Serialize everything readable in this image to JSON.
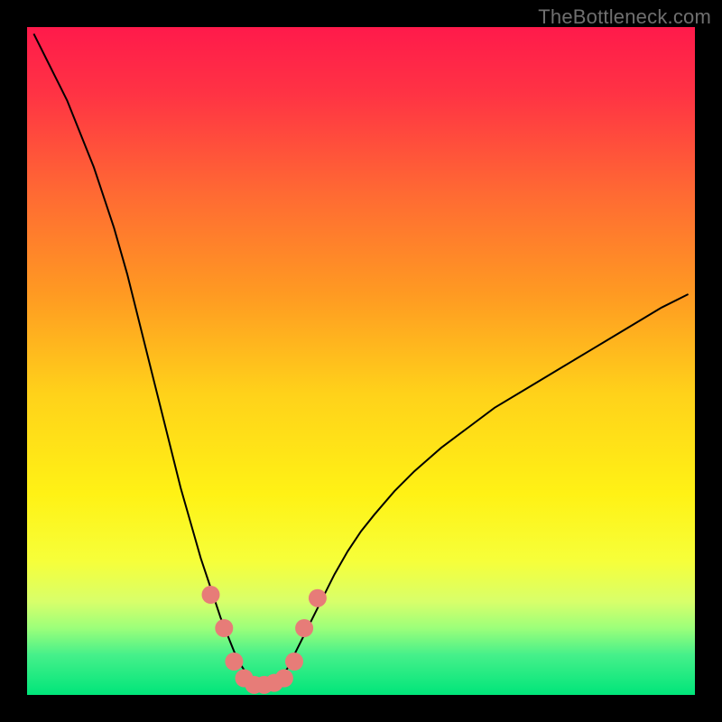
{
  "watermark": "TheBottleneck.com",
  "chart_data": {
    "type": "line",
    "title": "",
    "xlabel": "",
    "ylabel": "",
    "xlim": [
      0,
      100
    ],
    "ylim": [
      0,
      100
    ],
    "background_gradient": {
      "stops": [
        {
          "offset": 0.0,
          "color": "#ff1a4b"
        },
        {
          "offset": 0.1,
          "color": "#ff3344"
        },
        {
          "offset": 0.25,
          "color": "#ff6a33"
        },
        {
          "offset": 0.4,
          "color": "#ff9a22"
        },
        {
          "offset": 0.55,
          "color": "#ffd21a"
        },
        {
          "offset": 0.7,
          "color": "#fff215"
        },
        {
          "offset": 0.8,
          "color": "#f6ff3a"
        },
        {
          "offset": 0.86,
          "color": "#d8ff6a"
        },
        {
          "offset": 0.9,
          "color": "#9cff7a"
        },
        {
          "offset": 0.94,
          "color": "#46f08a"
        },
        {
          "offset": 1.0,
          "color": "#00e57a"
        }
      ]
    },
    "curve": {
      "description": "V-shaped bottleneck curve; y is high (≈100) at the edges, dips to ≈1 near x≈34, asymmetric right branch rising to ≈60",
      "color": "#000000",
      "width": 2,
      "x": [
        1.0,
        2.0,
        3.0,
        4.0,
        5.0,
        6.0,
        7.0,
        8.0,
        9.0,
        10.0,
        11.0,
        12.0,
        13.0,
        14.0,
        15.0,
        16.0,
        17.0,
        18.0,
        19.0,
        20.0,
        21.0,
        22.0,
        23.0,
        24.0,
        25.0,
        26.0,
        27.0,
        28.0,
        29.0,
        30.0,
        31.0,
        32.0,
        33.0,
        34.0,
        35.0,
        36.0,
        37.0,
        38.0,
        39.0,
        40.0,
        41.0,
        42.0,
        43.0,
        44.0,
        45.0,
        46.0,
        48.0,
        50.0,
        52.0,
        55.0,
        58.0,
        62.0,
        66.0,
        70.0,
        75.0,
        80.0,
        85.0,
        90.0,
        95.0,
        99.0
      ],
      "y": [
        99.0,
        97.0,
        95.0,
        93.0,
        91.0,
        89.0,
        86.5,
        84.0,
        81.5,
        79.0,
        76.0,
        73.0,
        70.0,
        66.5,
        63.0,
        59.0,
        55.0,
        51.0,
        47.0,
        43.0,
        39.0,
        35.0,
        31.0,
        27.5,
        24.0,
        20.5,
        17.5,
        14.5,
        11.5,
        9.0,
        6.5,
        4.5,
        3.0,
        1.5,
        1.2,
        1.2,
        1.5,
        2.5,
        4.0,
        6.0,
        8.0,
        10.0,
        12.0,
        14.0,
        16.0,
        18.0,
        21.5,
        24.5,
        27.0,
        30.5,
        33.5,
        37.0,
        40.0,
        43.0,
        46.0,
        49.0,
        52.0,
        55.0,
        58.0,
        60.0
      ]
    },
    "nodes": {
      "description": "Pink rounded nodes near the valley",
      "color": "#e77c78",
      "radius": 10,
      "points": [
        {
          "x": 27.5,
          "y": 15.0
        },
        {
          "x": 29.5,
          "y": 10.0
        },
        {
          "x": 31.0,
          "y": 5.0
        },
        {
          "x": 32.5,
          "y": 2.5
        },
        {
          "x": 34.0,
          "y": 1.5
        },
        {
          "x": 35.5,
          "y": 1.5
        },
        {
          "x": 37.0,
          "y": 1.8
        },
        {
          "x": 38.5,
          "y": 2.5
        },
        {
          "x": 40.0,
          "y": 5.0
        },
        {
          "x": 41.5,
          "y": 10.0
        },
        {
          "x": 43.5,
          "y": 14.5
        }
      ]
    }
  }
}
